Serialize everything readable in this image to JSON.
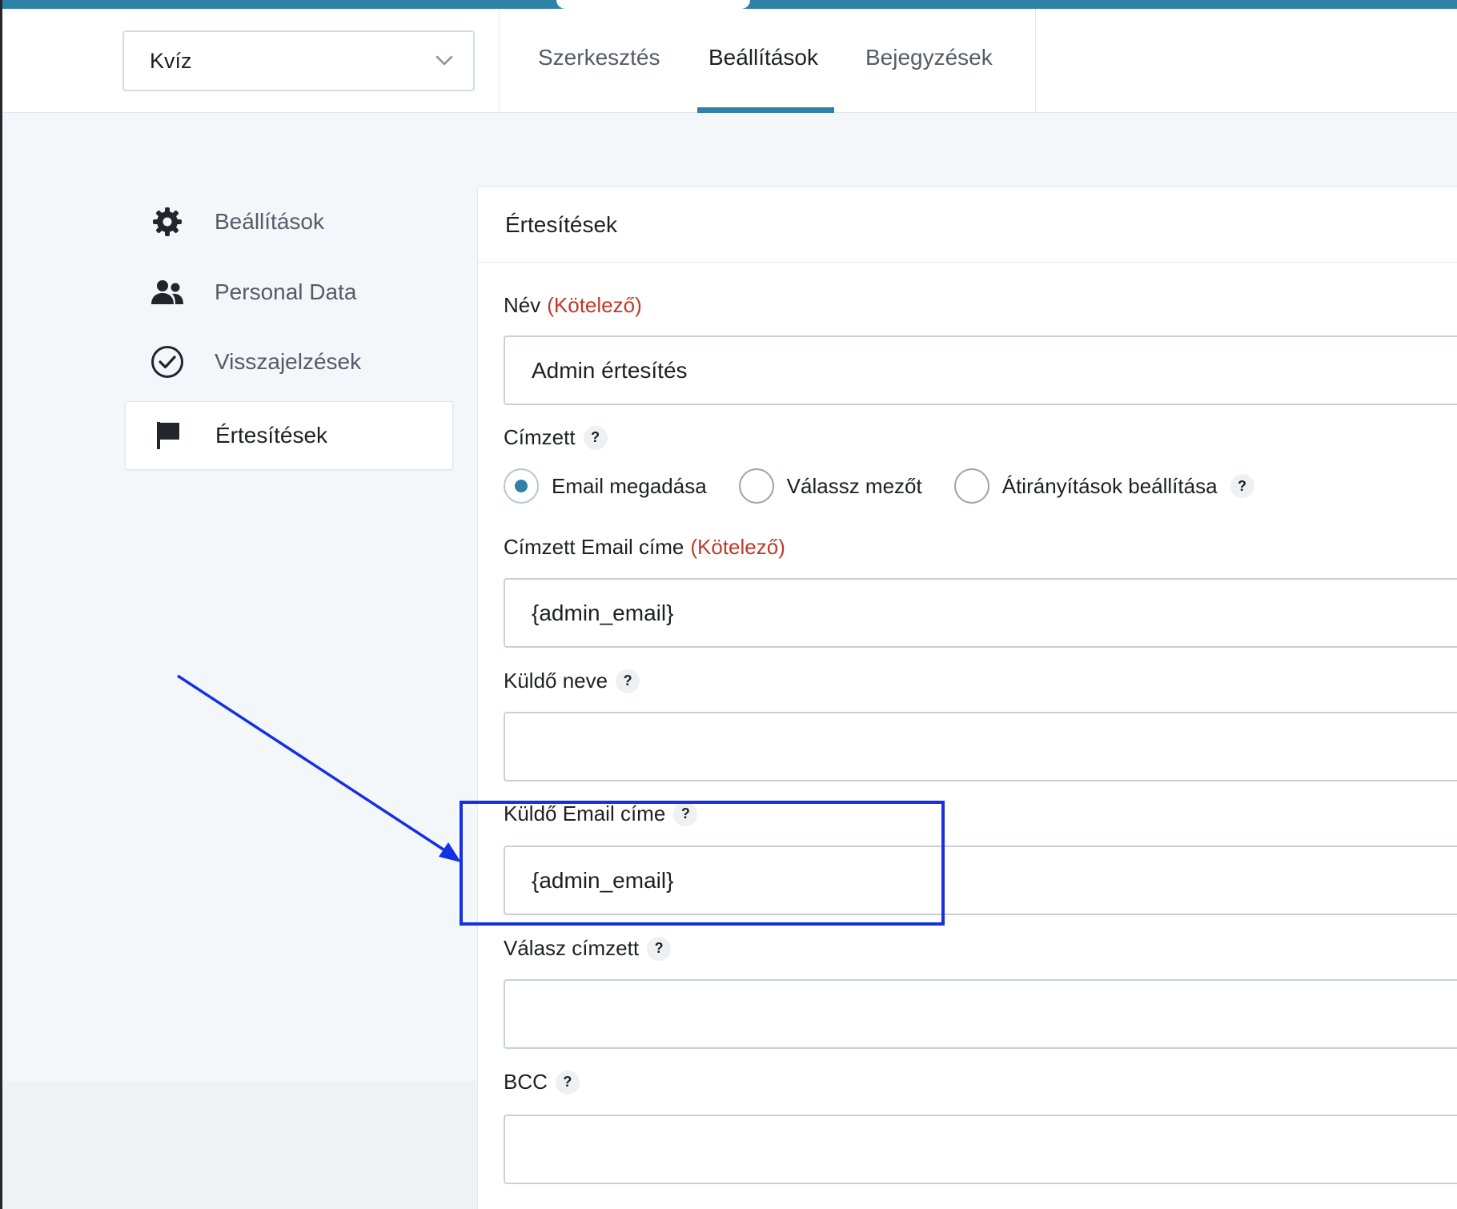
{
  "header": {
    "form_select": {
      "value": "Kvíz",
      "icon": "chevron-down-icon"
    },
    "tabs": [
      {
        "label": "Szerkesztés",
        "active": false
      },
      {
        "label": "Beállítások",
        "active": true
      },
      {
        "label": "Bejegyzések",
        "active": false
      }
    ]
  },
  "sidebar": {
    "items": [
      {
        "label": "Beállítások",
        "icon": "gear-icon",
        "active": false
      },
      {
        "label": "Personal Data",
        "icon": "users-icon",
        "active": false
      },
      {
        "label": "Visszajelzések",
        "icon": "check-circle-icon",
        "active": false
      },
      {
        "label": "Értesítések",
        "icon": "flag-icon",
        "active": true
      }
    ]
  },
  "panel": {
    "title": "Értesítések",
    "fields": {
      "name": {
        "label": "Név",
        "required": "(Kötelező)",
        "value": "Admin értesítés"
      },
      "recipient": {
        "label": "Címzett",
        "help": "?",
        "options": [
          {
            "label": "Email megadása",
            "selected": true
          },
          {
            "label": "Válassz mezőt",
            "selected": false
          },
          {
            "label": "Átirányítások beállítása",
            "selected": false,
            "help": "?"
          }
        ]
      },
      "recipient_email": {
        "label": "Címzett Email címe",
        "required": "(Kötelező)",
        "value": "{admin_email}"
      },
      "sender_name": {
        "label": "Küldő neve",
        "help": "?",
        "value": ""
      },
      "sender_email": {
        "label": "Küldő Email címe",
        "help": "?",
        "value": "{admin_email}"
      },
      "reply_to": {
        "label": "Válasz címzett",
        "help": "?",
        "value": ""
      },
      "bcc": {
        "label": "BCC",
        "help": "?",
        "value": ""
      }
    }
  },
  "colors": {
    "accent": "#2f80a7",
    "required": "#c0392b",
    "annotation": "#1530e0"
  }
}
